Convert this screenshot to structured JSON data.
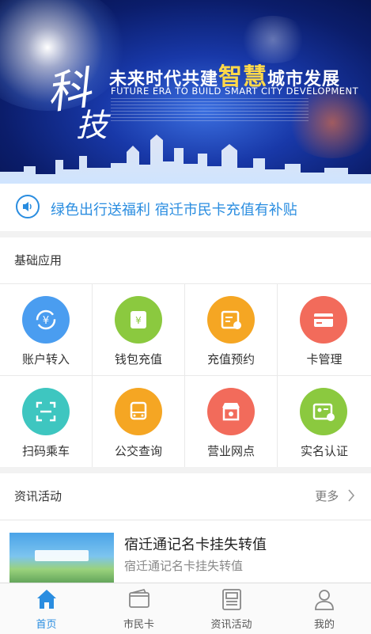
{
  "banner": {
    "calligraphy_1": "科",
    "calligraphy_2": "技",
    "title_a": "未来时代共建",
    "title_big": "智慧",
    "title_b": "城市发展",
    "subtitle": "FUTURE ERA TO BUILD SMART CITY DEVELOPMENT"
  },
  "notice": {
    "icon": "speaker-icon",
    "text": "绿色出行送福利 宿迁市民卡充值有补贴"
  },
  "basic_apps": {
    "heading": "基础应用",
    "items": [
      {
        "label": "账户转入",
        "icon": "transfer-icon",
        "color": "#4a9df0"
      },
      {
        "label": "钱包充值",
        "icon": "wallet-recharge-icon",
        "color": "#8bc93f"
      },
      {
        "label": "充值预约",
        "icon": "calendar-clock-icon",
        "color": "#f5a623"
      },
      {
        "label": "卡管理",
        "icon": "card-icon",
        "color": "#f26b5b"
      },
      {
        "label": "扫码乘车",
        "icon": "scan-icon",
        "color": "#3ec6c0"
      },
      {
        "label": "公交查询",
        "icon": "bus-icon",
        "color": "#f5a623"
      },
      {
        "label": "营业网点",
        "icon": "store-icon",
        "color": "#f26b5b"
      },
      {
        "label": "实名认证",
        "icon": "id-verify-icon",
        "color": "#8bc93f"
      }
    ]
  },
  "news": {
    "heading": "资讯活动",
    "more_label": "更多",
    "items": [
      {
        "title": "宿迁通记名卡挂失转值",
        "summary": "宿迁通记名卡挂失转值"
      }
    ]
  },
  "tabbar": {
    "items": [
      {
        "label": "首页",
        "icon": "home-icon",
        "active": true
      },
      {
        "label": "市民卡",
        "icon": "card-wallet-icon",
        "active": false
      },
      {
        "label": "资讯活动",
        "icon": "news-icon",
        "active": false
      },
      {
        "label": "我的",
        "icon": "user-icon",
        "active": false
      }
    ]
  },
  "colors": {
    "accent": "#2a8de0"
  }
}
